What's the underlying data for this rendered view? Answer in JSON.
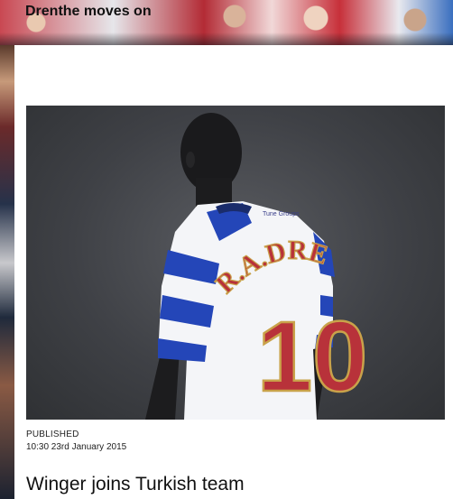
{
  "header": {
    "title": "Drenthe moves on"
  },
  "article": {
    "photo": {
      "shirt_name": "R.A.DRENTHE",
      "shirt_number": "10",
      "sponsor_label": "Tune Groups"
    },
    "published_label": "PUBLISHED",
    "timestamp": "10:30 23rd January 2015",
    "headline": "Winger joins Turkish team"
  },
  "colors": {
    "shirt_blue": "#2446b8",
    "shirt_white": "#f4f5f8",
    "number_red": "#b8323a",
    "number_gold": "#c9a24a"
  }
}
